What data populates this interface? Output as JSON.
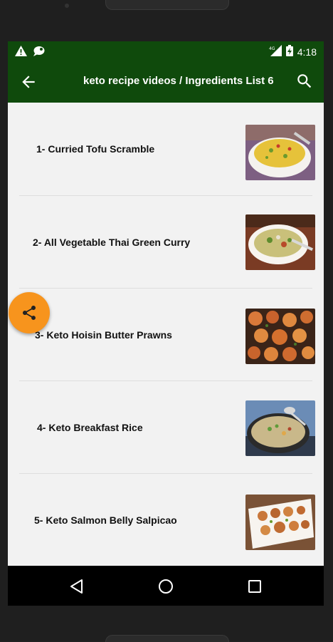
{
  "status_bar": {
    "time": "4:18",
    "left_icons": [
      "warning-icon",
      "notification-bubble-icon"
    ],
    "right_icons": [
      "signal-4g-icon",
      "battery-charging-icon"
    ]
  },
  "app_bar": {
    "title": "keto recipe videos / Ingredients List 6",
    "back_icon": "arrow-back-icon",
    "search_icon": "search-icon",
    "color": "#0f4a0c"
  },
  "recipes": [
    {
      "label": "1- Curried Tofu Scramble",
      "thumbnail": "curried-tofu-scramble-photo"
    },
    {
      "label": "2- All Vegetable Thai Green Curry",
      "thumbnail": "thai-green-curry-photo"
    },
    {
      "label": "3- Keto Hoisin Butter Prawns",
      "thumbnail": "hoisin-butter-prawns-photo"
    },
    {
      "label": "4- Keto Breakfast Rice",
      "thumbnail": "keto-breakfast-rice-photo"
    },
    {
      "label": "5- Keto Salmon Belly Salpicao",
      "thumbnail": "salmon-belly-salpicao-photo"
    }
  ],
  "fab": {
    "icon": "share-icon",
    "color": "#f7941d"
  },
  "nav_bar": {
    "buttons": [
      "back-triangle-icon",
      "home-circle-icon",
      "recents-square-icon"
    ]
  }
}
